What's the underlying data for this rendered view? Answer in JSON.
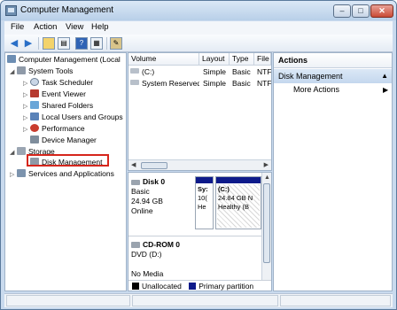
{
  "window": {
    "title": "Computer Management",
    "minimize": "–",
    "maximize": "□",
    "close": "✕"
  },
  "menu": [
    "File",
    "Action",
    "View",
    "Help"
  ],
  "toolbar": {
    "icons": [
      "back-icon",
      "forward-icon",
      "up-folder-icon",
      "show-hide-tree-icon",
      "help-icon",
      "properties-icon",
      "export-icon"
    ]
  },
  "tree": [
    {
      "label": "Computer Management (Local",
      "icon": "computer-icon",
      "twisty": "◢",
      "level": 0
    },
    {
      "label": "System Tools",
      "icon": "system-tools-icon",
      "twisty": "◢",
      "level": 1
    },
    {
      "label": "Task Scheduler",
      "icon": "task-scheduler-icon",
      "twisty": "▷",
      "level": 2
    },
    {
      "label": "Event Viewer",
      "icon": "event-viewer-icon",
      "twisty": "▷",
      "level": 2
    },
    {
      "label": "Shared Folders",
      "icon": "shared-folders-icon",
      "twisty": "▷",
      "level": 2
    },
    {
      "label": "Local Users and Groups",
      "icon": "users-icon",
      "twisty": "▷",
      "level": 2
    },
    {
      "label": "Performance",
      "icon": "performance-icon",
      "twisty": "▷",
      "level": 2
    },
    {
      "label": "Device Manager",
      "icon": "device-manager-icon",
      "twisty": "",
      "level": 2
    },
    {
      "label": "Storage",
      "icon": "storage-icon",
      "twisty": "◢",
      "level": 1
    },
    {
      "label": "Disk Management",
      "icon": "disk-management-icon",
      "twisty": "",
      "level": 2
    },
    {
      "label": "Services and Applications",
      "icon": "services-icon",
      "twisty": "▷",
      "level": 1
    }
  ],
  "volumes": {
    "columns": [
      "Volume",
      "Layout",
      "Type",
      "File"
    ],
    "rows": [
      [
        "(C:)",
        "Simple",
        "Basic",
        "NTF"
      ],
      [
        "System Reserved",
        "Simple",
        "Basic",
        "NTF"
      ]
    ]
  },
  "disks": [
    {
      "name": "Disk 0",
      "type": "Basic",
      "size": "24.94 GB",
      "status": "Online",
      "partitions": [
        {
          "lines": [
            "Sy:",
            "10(",
            "He"
          ]
        },
        {
          "lines": [
            "(C:)",
            "24.84 GB N",
            "Healthy (B"
          ]
        }
      ]
    },
    {
      "name": "CD-ROM 0",
      "type": "DVD (D:)",
      "size": "",
      "status": "No Media",
      "partitions": []
    }
  ],
  "legend": [
    {
      "label": "Unallocated",
      "color": "#000000"
    },
    {
      "label": "Primary partition",
      "color": "#0d1a8a"
    }
  ],
  "actions": {
    "header": "Actions",
    "section": "Disk Management",
    "more": "More Actions",
    "section_arrow": "▲",
    "more_arrow": "▶"
  }
}
